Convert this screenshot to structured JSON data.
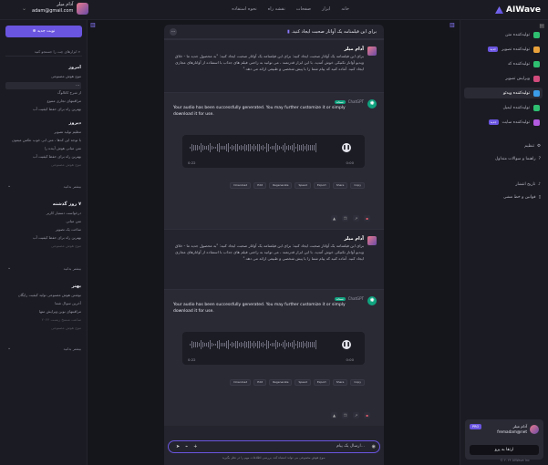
{
  "app": {
    "brand": "AIWave",
    "brand_color": "#6a55e0"
  },
  "nav": [
    "خانه",
    "ابزار",
    "صفحات",
    "نقشه راه",
    "نحوه استفاده"
  ],
  "user": {
    "name": "آدام میلر",
    "email": "adam@gmail.com"
  },
  "sidebar_right": {
    "tools": [
      {
        "label": "تولیدکننده متن",
        "color": "#2fbf71"
      },
      {
        "label": "تولیدکننده تصویر",
        "color": "#e9a23b",
        "badge": "جدید"
      },
      {
        "label": "تولیدکننده کد",
        "color": "#2fbf71"
      },
      {
        "label": "ویرایش تصویر",
        "color": "#d24b7c"
      },
      {
        "label": "تولیدکننده ویدئو",
        "color": "#3b9ce9"
      },
      {
        "label": "تولیدکننده ایمیل",
        "color": "#2fbf71"
      },
      {
        "label": "تولیدکننده سایت",
        "color": "#b35be0",
        "badge": "جدید"
      }
    ],
    "settings": "تنظیم",
    "help": "راهنما و سوالات متداول",
    "history": "تاریخ انتشار",
    "terms": "قوانین و خط مشی",
    "card": {
      "name": "آدام میلر",
      "email": "fremadam@net",
      "badge": "PRO",
      "button": "ارتقا به پرو"
    },
    "copyright": "© ۲۰۲۴ AIWave Inc"
  },
  "sidebar_left": {
    "new_chat": "نوبت جدید",
    "search": "ابزارهای چت را جستجو کنید",
    "groups": [
      {
        "title": "امروز",
        "items": [
          "موج هوش مصنوعی",
          "...",
          "از شرح کاتالوگ",
          "مراقبتهای تجاری متنوع",
          "بهترین راه برای حفظ کیفیت آب"
        ]
      },
      {
        "title": "دیروز",
        "items": [
          "تنظیم تولید تصویر",
          "با توجه این کدها ، متن ابی خوب عکس میمون",
          "متن مبانی هوش آینده را",
          "بهترین راه برای حفظ کیفیت آب",
          "موج هوش مصنوعی"
        ]
      },
      {
        "title": "۷ روز گذشته",
        "items": [
          "درخواست دستیار کاربر",
          "متن مبانی",
          "ساخت یک تصویر",
          "بهترین راه برای حفظ کیفیت آب",
          "موج هوش مصنوعی"
        ]
      },
      {
        "title": "بهتر",
        "items": [
          "نوشتن هوش مصنوعی تولید کیفیت رایگان",
          "آخرین سوال شما",
          "مراقبتهای نوین ویرایش متها",
          "ساعت منسخ زیست ۲۰۲۴",
          "موج هوش مصنوعی"
        ]
      }
    ],
    "more": "بیشتر بدانید"
  },
  "chat": {
    "title": "برای این فیلمنامه یک آواتار صحبت ایجاد کنید.",
    "messages": [
      {
        "role": "user",
        "name": "آدام میلر",
        "text": "برای این فیلمنامه یک آواتار صحبت ایجاد کنید: برای این فیلمنامه یک آواتار صحبت ایجاد کنید: \"به محصول جدید ما - خلاق ویدیو آواتار تکنیکی خوش آمدید. با این ابزار قدرتمند ، می توانید به راحتی فیلم های جذاب با استفاده از آواتارهای مجازی ایجاد کنید. آماده کنید که پیام شما را با پیش شخصی و طبیعی ارائه می دهد.\""
      },
      {
        "role": "bot",
        "name": "ChatGPT",
        "tag": "نسخه",
        "text": "Your audio has been successfully generated. You may further customize it or simply download it for use.",
        "time_start": "0:00",
        "time_end": "0:22",
        "chips": [
          "Download",
          "Edit",
          "Regenerate",
          "Speed",
          "Export",
          "Share",
          "Copy"
        ]
      },
      {
        "role": "user",
        "name": "آدام میلر",
        "text": "برای این فیلمنامه یک آواتار صحبت ایجاد کنید: برای این فیلمنامه یک آواتار صحبت ایجاد کنید: \"به محصول جدید ما - خلاق ویدیو آواتار تکنیکی خوش آمدید. با این ابزار قدرتمند ، می توانید به راحتی فیلم های جذاب با استفاده از آواتارهای مجازی ایجاد کنید. آماده کنید که پیام شما را با پیش شخصی و طبیعی ارائه می دهد.\""
      },
      {
        "role": "bot",
        "name": "ChatGPT",
        "tag": "نسخه",
        "text": "Your audio has been successfully generated. You may further customize it or simply download it for use.",
        "time_start": "0:00",
        "time_end": "0:22",
        "chips": [
          "Download",
          "Edit",
          "Regenerate",
          "Speed",
          "Export",
          "Share",
          "Copy"
        ]
      }
    ],
    "input_placeholder": "ارسال یک پیام...",
    "disclaimer": "موج هوش مصنوعی می تواند اشتباه کند. بررسی اطلاعات مهم را در نظر بگیرید."
  }
}
